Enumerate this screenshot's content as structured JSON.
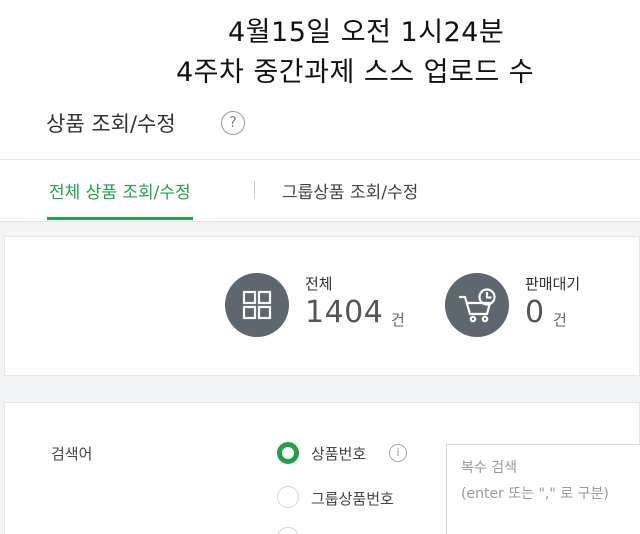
{
  "caption": {
    "line1": "4월15일 오전 1시24분",
    "line2": "4주차 중간과제 스스 업로드 수"
  },
  "page": {
    "title": "상품 조회/수정",
    "help_icon": "question-circle-icon"
  },
  "tabs": [
    {
      "label": "전체 상품 조회/수정",
      "active": true
    },
    {
      "label": "그룹상품 조회/수정",
      "active": false
    }
  ],
  "summary": {
    "total": {
      "label": "전체",
      "value": "1404",
      "unit": "건",
      "icon": "grid-icon"
    },
    "pending": {
      "label": "판매대기",
      "value": "0",
      "unit": "건",
      "icon": "cart-clock-icon"
    }
  },
  "search": {
    "field_label": "검색어",
    "options": [
      {
        "label": "상품번호",
        "selected": true,
        "info_icon": "info-icon"
      },
      {
        "label": "그룹상품번호",
        "selected": false
      }
    ],
    "multi_search": {
      "title": "복수 검색",
      "hint": "(enter 또는 \",\" 로 구분)"
    }
  },
  "colors": {
    "accent": "#1fa34a",
    "icon_circle": "#5e6670",
    "background": "#f3f4f6"
  }
}
